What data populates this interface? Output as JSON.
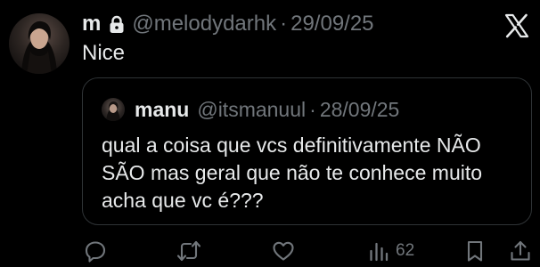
{
  "tweet": {
    "author_name": "m",
    "author_handle": "@melodydarhk",
    "separator": "·",
    "date": "29/09/25",
    "text": "Nice",
    "locked": true
  },
  "quote": {
    "author_name": "manu",
    "author_handle": "@itsmanuul",
    "separator": "·",
    "date": "28/09/25",
    "text": "qual a coisa que vcs definitivamente NÃO SÃO mas geral que não te conhece muito acha que vc é???"
  },
  "actions": {
    "views_count": "62"
  },
  "icons": {
    "logo": "x-logo",
    "lock": "lock-icon",
    "reply": "reply-icon",
    "retweet": "retweet-icon",
    "like": "heart-icon",
    "views": "views-icon",
    "bookmark": "bookmark-icon",
    "share": "share-icon"
  },
  "colors": {
    "background": "#000000",
    "primary_text": "#e7e9ea",
    "secondary_text": "#71767b",
    "border": "#2f3336"
  }
}
